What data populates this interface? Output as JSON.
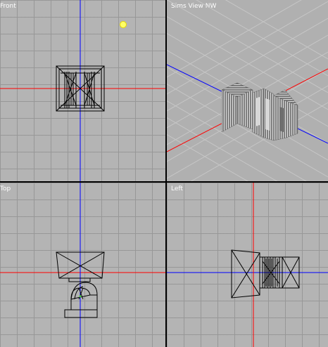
{
  "viewports": {
    "front": {
      "label": "Front"
    },
    "sims": {
      "label": "Sims View NW"
    },
    "top": {
      "label": "Top"
    },
    "left": {
      "label": "Left"
    }
  },
  "colors": {
    "axis_x": "#ff0000",
    "axis_y": "#0000ff",
    "grid": "#969696",
    "background": "#b4b4b4",
    "wireframe": "#000000",
    "light": "#ffff66"
  }
}
